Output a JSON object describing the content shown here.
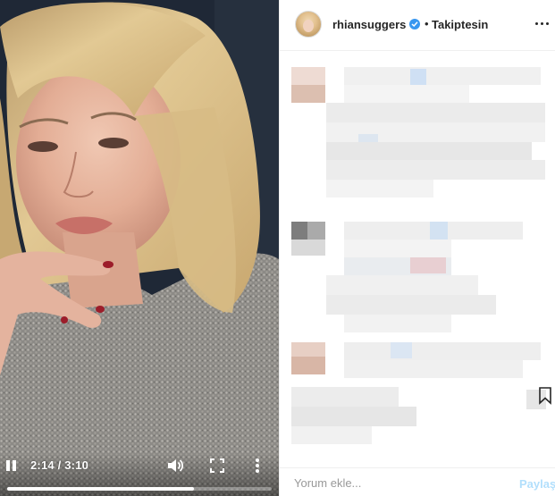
{
  "video": {
    "current_time": "2:14",
    "duration": "3:10",
    "time_display": "2:14 / 3:10",
    "progress_fraction": 0.705,
    "state": "playing",
    "controls": [
      "pause-icon",
      "volume-icon",
      "fullscreen-icon",
      "more-vertical-icon"
    ]
  },
  "header": {
    "username": "rhiansuggers",
    "verified": true,
    "separator": "•",
    "follow_status": "Takiptesin",
    "options_icon": "more-horizontal-icon"
  },
  "comments": {
    "content": "pixelated / blurred",
    "blocks": 3
  },
  "comment_bar": {
    "placeholder": "Yorum ekle...",
    "share_label": "Paylaş"
  },
  "colors": {
    "accent_blue": "#3897f0",
    "share_disabled": "#b2dffc",
    "text": "#262626",
    "border": "#efefef"
  }
}
